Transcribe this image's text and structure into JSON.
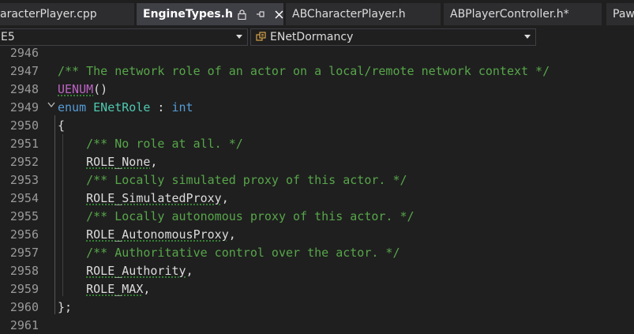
{
  "tabs": [
    {
      "label": "aracterPlayer.cpp"
    },
    {
      "label": "EngineTypes.h",
      "active": true
    },
    {
      "label": "ABCharacterPlayer.h"
    },
    {
      "label": "ABPlayerController.h*"
    },
    {
      "label": "Paw"
    }
  ],
  "nav": {
    "scope_value": "E5",
    "member_value": "ENetDormancy"
  },
  "lines": [
    {
      "num": "2946",
      "tokens": []
    },
    {
      "num": "2947",
      "tokens": [
        {
          "t": "/** The network role of an actor on a local/remote network context */",
          "c": "c-comment"
        }
      ]
    },
    {
      "num": "2948",
      "tokens": [
        {
          "t": "UENUM",
          "c": "c-macro squig-m"
        },
        {
          "t": "()",
          "c": "c-punct"
        }
      ]
    },
    {
      "num": "2949",
      "tokens": [
        {
          "t": "enum",
          "c": "c-kw"
        },
        {
          "t": " ",
          "c": ""
        },
        {
          "t": "ENetRole",
          "c": "c-type"
        },
        {
          "t": " : ",
          "c": "c-punct"
        },
        {
          "t": "int",
          "c": "c-kw"
        }
      ]
    },
    {
      "num": "2950",
      "tokens": [
        {
          "t": "{",
          "c": "c-punct"
        }
      ]
    },
    {
      "num": "2951",
      "tokens": [
        {
          "t": "    ",
          "c": ""
        },
        {
          "t": "/** No role at all. */",
          "c": "c-comment"
        }
      ]
    },
    {
      "num": "2952",
      "tokens": [
        {
          "t": "    ",
          "c": ""
        },
        {
          "t": "ROLE_None",
          "c": "c-enum squig"
        },
        {
          "t": ",",
          "c": "c-punct"
        }
      ]
    },
    {
      "num": "2953",
      "tokens": [
        {
          "t": "    ",
          "c": ""
        },
        {
          "t": "/** Locally simulated proxy of this actor. */",
          "c": "c-comment"
        }
      ]
    },
    {
      "num": "2954",
      "tokens": [
        {
          "t": "    ",
          "c": ""
        },
        {
          "t": "ROLE_SimulatedProxy",
          "c": "c-enum squig"
        },
        {
          "t": ",",
          "c": "c-punct"
        }
      ]
    },
    {
      "num": "2955",
      "tokens": [
        {
          "t": "    ",
          "c": ""
        },
        {
          "t": "/** Locally autonomous proxy of this actor. */",
          "c": "c-comment"
        }
      ]
    },
    {
      "num": "2956",
      "tokens": [
        {
          "t": "    ",
          "c": ""
        },
        {
          "t": "ROLE_AutonomousProxy",
          "c": "c-enum squig"
        },
        {
          "t": ",",
          "c": "c-punct"
        }
      ]
    },
    {
      "num": "2957",
      "tokens": [
        {
          "t": "    ",
          "c": ""
        },
        {
          "t": "/** Authoritative control over the actor. */",
          "c": "c-comment"
        }
      ]
    },
    {
      "num": "2958",
      "tokens": [
        {
          "t": "    ",
          "c": ""
        },
        {
          "t": "ROLE_Authority",
          "c": "c-enum squig"
        },
        {
          "t": ",",
          "c": "c-punct"
        }
      ]
    },
    {
      "num": "2959",
      "tokens": [
        {
          "t": "    ",
          "c": ""
        },
        {
          "t": "ROLE_MAX",
          "c": "c-enum squig"
        },
        {
          "t": ",",
          "c": "c-punct"
        }
      ]
    },
    {
      "num": "2960",
      "tokens": [
        {
          "t": "};",
          "c": "c-punct"
        }
      ]
    },
    {
      "num": "2961",
      "tokens": []
    }
  ],
  "colors": {
    "comment": "#57a64a",
    "keyword": "#569cd6",
    "type": "#4ec9b0",
    "macro": "#bd63c5",
    "background": "#1f1f1f"
  }
}
